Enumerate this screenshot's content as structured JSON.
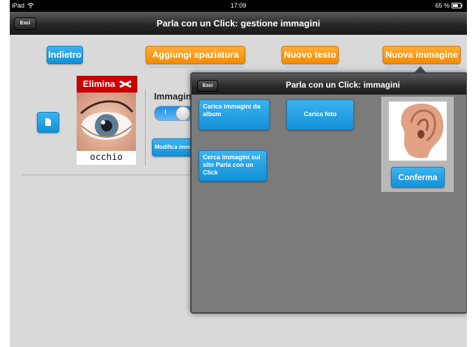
{
  "status": {
    "device": "iPad",
    "time": "17:09",
    "battery": "65 %"
  },
  "nav": {
    "exit_label": "Esci",
    "title": "Parla con un Click: gestione immagini"
  },
  "toolbar": {
    "back_label": "Indietro",
    "add_spacing_label": "Aggiungi spaziatura",
    "new_text_label": "Nuovo testo",
    "new_image_label": "Nuova immagine"
  },
  "card": {
    "delete_label": "Elimina",
    "word": "occhio",
    "images_label": "Immagin",
    "edit_image_label": "Modifica imm"
  },
  "popover": {
    "exit_label": "Esci",
    "title": "Parla con un Click: immagini",
    "load_album_label": "Carica immagini da album",
    "load_photo_label": "Carica foto",
    "search_site_label": "Cerca immagini sul sito Parla con un Click",
    "confirm_label": "Conferma"
  },
  "colors": {
    "accent_orange": "#f59a12",
    "accent_blue": "#1aa0e4",
    "delete_red": "#d40000"
  }
}
